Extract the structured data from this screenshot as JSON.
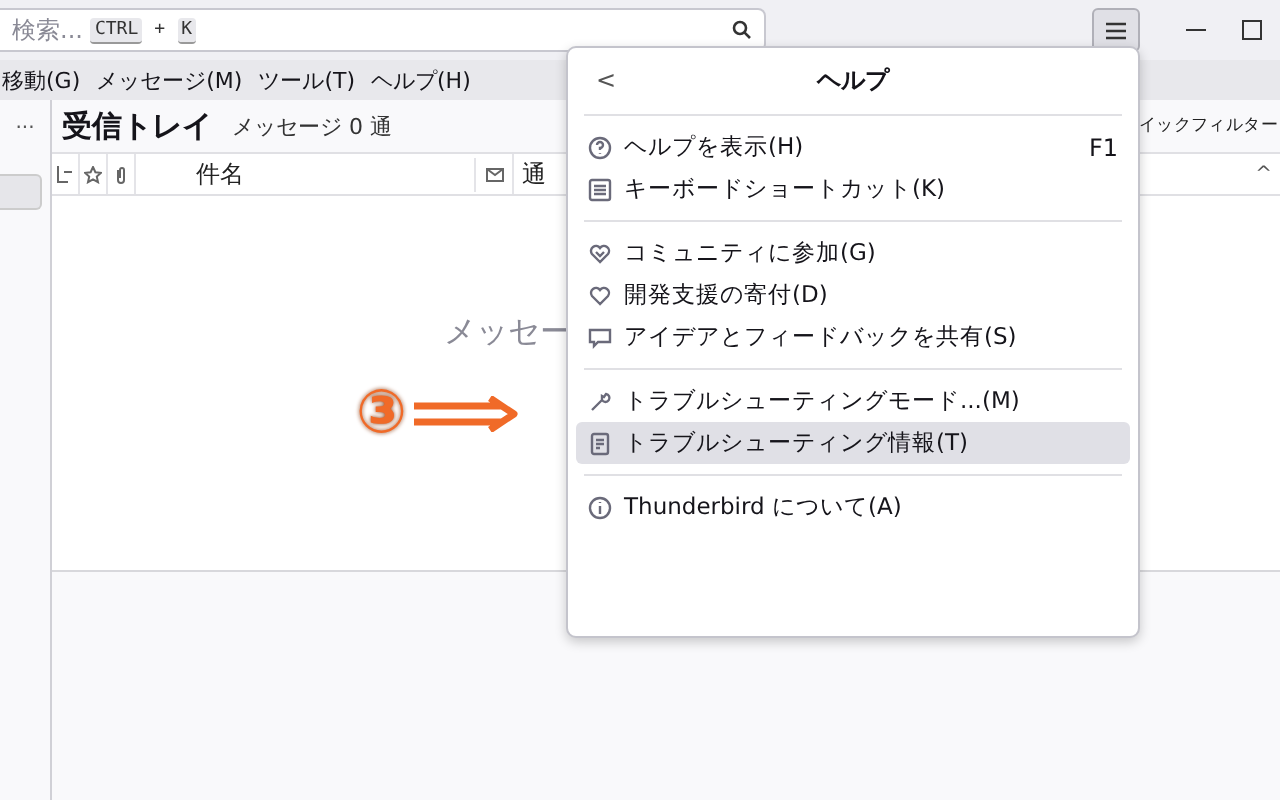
{
  "search": {
    "placeholder": "検索...",
    "keys": [
      "CTRL",
      "+",
      "K"
    ]
  },
  "menubar": [
    "移動(G)",
    "メッセージ(M)",
    "ツール(T)",
    "ヘルプ(H)"
  ],
  "folder": {
    "more": "...",
    "title": "受信トレイ",
    "count": "メッセージ 0 通",
    "quick_filter": "イックフィルター"
  },
  "columns": [
    {
      "kind": "thread"
    },
    {
      "kind": "star"
    },
    {
      "kind": "attach"
    },
    {
      "kind": "text",
      "label": "件名"
    },
    {
      "kind": "unread"
    },
    {
      "kind": "text",
      "label": "通"
    }
  ],
  "sort_arrow": "^",
  "empty_message": "メッセー",
  "annotation": {
    "label": "③"
  },
  "help_menu": {
    "back": "<",
    "title": "ヘルプ",
    "items": [
      {
        "kind": "item",
        "label": "ヘルプを表示(H)",
        "shortcut": "F1",
        "selected": false
      },
      {
        "kind": "item",
        "label": "キーボードショートカット(K)",
        "selected": false
      },
      {
        "kind": "separator"
      },
      {
        "kind": "item",
        "label": "コミュニティに参加(G)",
        "selected": false
      },
      {
        "kind": "item",
        "label": "開発支援の寄付(D)",
        "selected": false
      },
      {
        "kind": "item",
        "label": "アイデアとフィードバックを共有(S)",
        "selected": false
      },
      {
        "kind": "separator"
      },
      {
        "kind": "item",
        "label": "トラブルシューティングモード...(M)",
        "selected": false
      },
      {
        "kind": "item",
        "label": "トラブルシューティング情報(T)",
        "selected": true
      },
      {
        "kind": "separator"
      },
      {
        "kind": "item",
        "label": "Thunderbird について(A)",
        "selected": false
      }
    ]
  }
}
